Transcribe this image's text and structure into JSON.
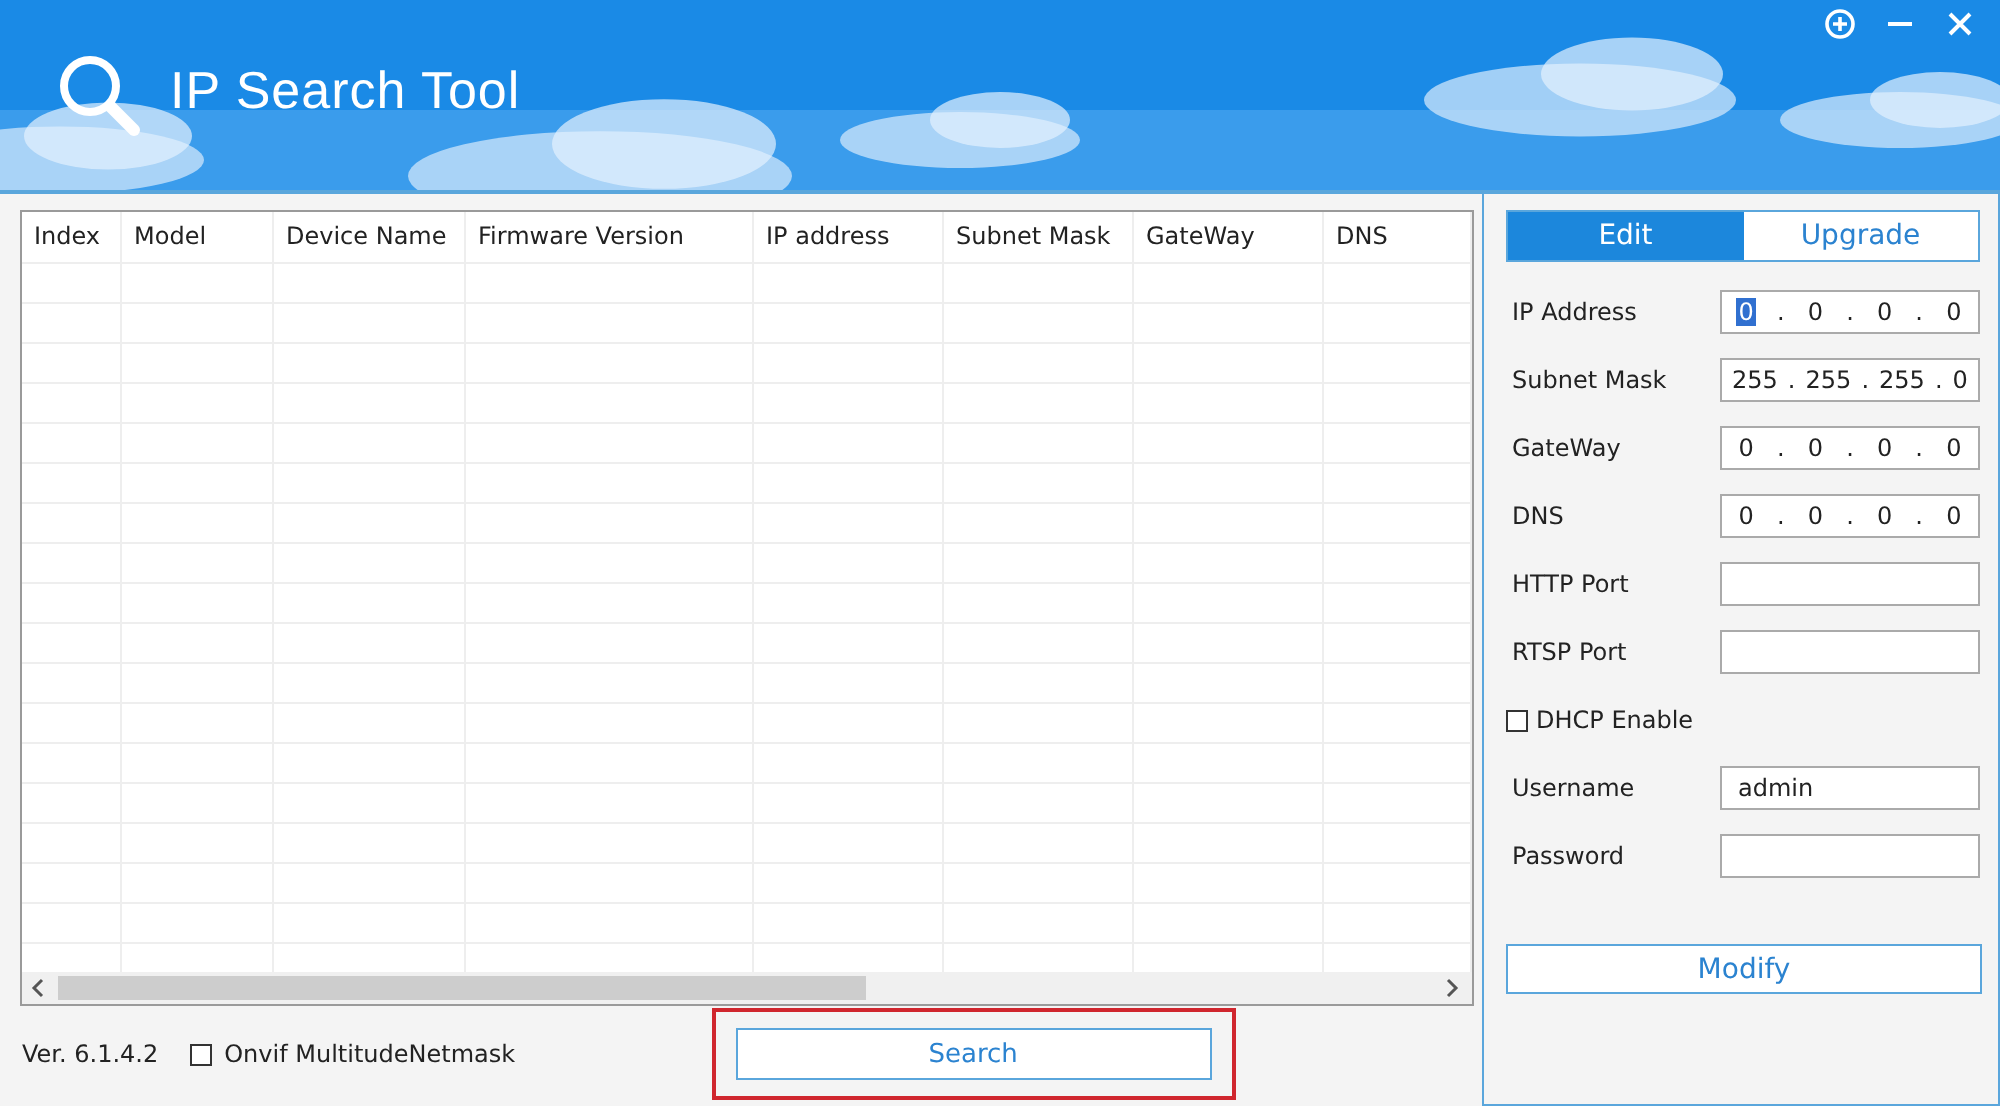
{
  "window": {
    "title": "IP Search Tool"
  },
  "table": {
    "columns": [
      "Index",
      "Model",
      "Device Name",
      "Firmware Version",
      "IP address",
      "Subnet Mask",
      "GateWay",
      "DNS"
    ]
  },
  "footer": {
    "version": "Ver. 6.1.4.2",
    "onvif": {
      "label": "Onvif MultitudeNetmask",
      "checked": false
    },
    "search_button": {
      "label": "Search",
      "highlighted": true
    }
  },
  "tabs": [
    {
      "label": "Edit",
      "selected": true
    },
    {
      "label": "Upgrade",
      "selected": false
    }
  ],
  "form": [
    {
      "kind": "ip",
      "label": "IP Address",
      "separator": ".",
      "octets": [
        {
          "text": "0",
          "selected": true
        },
        {
          "text": "0",
          "selected": false
        },
        {
          "text": "0",
          "selected": false
        },
        {
          "text": "0",
          "selected": false
        }
      ]
    },
    {
      "kind": "ip",
      "label": "Subnet Mask",
      "separator": ".",
      "octets": [
        {
          "text": "255",
          "selected": false
        },
        {
          "text": "255",
          "selected": false
        },
        {
          "text": "255",
          "selected": false
        },
        {
          "text": "0",
          "selected": false
        }
      ]
    },
    {
      "kind": "ip",
      "label": "GateWay",
      "separator": ".",
      "octets": [
        {
          "text": "0",
          "selected": false
        },
        {
          "text": "0",
          "selected": false
        },
        {
          "text": "0",
          "selected": false
        },
        {
          "text": "0",
          "selected": false
        }
      ]
    },
    {
      "kind": "ip",
      "label": "DNS",
      "separator": ".",
      "octets": [
        {
          "text": "0",
          "selected": false
        },
        {
          "text": "0",
          "selected": false
        },
        {
          "text": "0",
          "selected": false
        },
        {
          "text": "0",
          "selected": false
        }
      ]
    },
    {
      "kind": "text",
      "label": "HTTP Port"
    },
    {
      "kind": "text",
      "label": "RTSP Port"
    },
    {
      "kind": "checkbox",
      "label": "DHCP Enable",
      "checked": false
    },
    {
      "kind": "text",
      "label": "Username",
      "value": "admin"
    },
    {
      "kind": "text",
      "label": "Password"
    }
  ],
  "modify_button": {
    "label": "Modify"
  }
}
